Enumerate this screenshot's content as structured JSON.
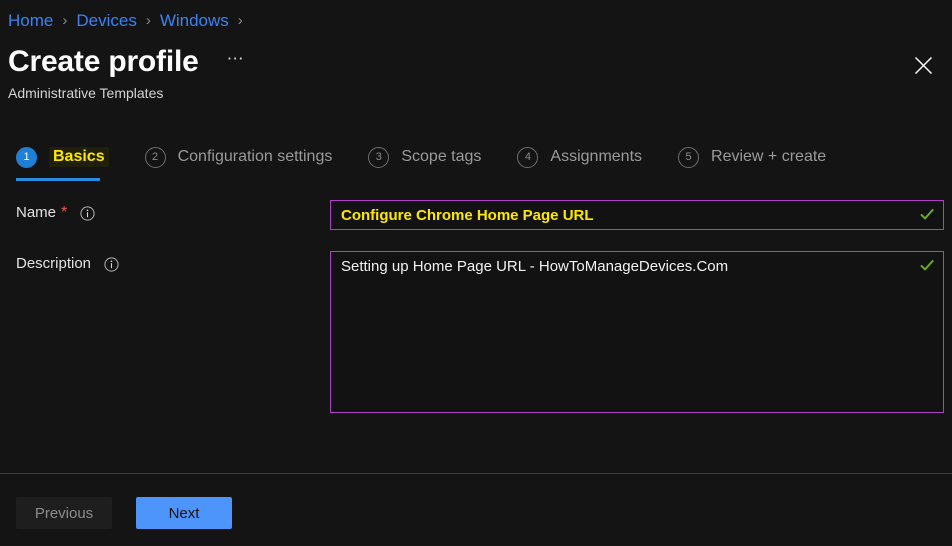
{
  "breadcrumb": {
    "items": [
      "Home",
      "Devices",
      "Windows"
    ],
    "separator": "›",
    "trailing_separator": "›"
  },
  "header": {
    "title": "Create profile",
    "subtitle": "Administrative Templates",
    "ellipsis_label": "⋯",
    "close_label": "Close",
    "close_icon": "close-icon"
  },
  "wizard": {
    "tabs": [
      {
        "number": "1",
        "label": "Basics",
        "state": "active"
      },
      {
        "number": "2",
        "label": "Configuration settings",
        "state": "inactive"
      },
      {
        "number": "3",
        "label": "Scope tags",
        "state": "inactive"
      },
      {
        "number": "4",
        "label": "Assignments",
        "state": "inactive"
      },
      {
        "number": "5",
        "label": "Review + create",
        "state": "inactive"
      }
    ]
  },
  "form": {
    "name": {
      "label": "Name",
      "required_marker": "*",
      "info_icon": "info-icon",
      "value": "Configure Chrome Home Page URL",
      "placeholder": "",
      "valid_icon": "checkmark-icon"
    },
    "description": {
      "label": "Description",
      "info_icon": "info-icon",
      "value": "Setting up Home Page URL - HowToManageDevices.Com",
      "placeholder": "",
      "valid_icon": "checkmark-icon"
    }
  },
  "footer": {
    "previous_label": "Previous",
    "next_label": "Next"
  },
  "colors": {
    "background": "#141414",
    "link": "#3b82f6",
    "accent_blue": "#4d94fb",
    "tab_active_badge": "#1f7fd4",
    "tab_underline": "#2a8ce0",
    "highlight_text": "#ffe800",
    "field_border": "#ac3fc4",
    "valid_check": "#6ab023",
    "required_star": "#e8564a"
  }
}
